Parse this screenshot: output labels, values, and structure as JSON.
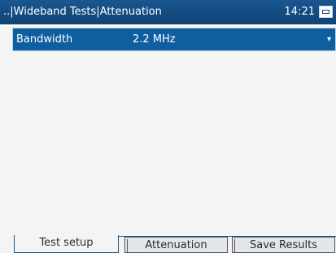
{
  "header": {
    "title": "..|Wideband Tests|Attenuation",
    "time": "14:21",
    "status_icon": "battery-charging-icon"
  },
  "parameters": [
    {
      "label": "Bandwidth",
      "value": "2.2 MHz"
    }
  ],
  "tabs": [
    {
      "label": "Test setup",
      "active": true
    },
    {
      "label": "Attenuation",
      "active": false
    },
    {
      "label": "Save Results",
      "active": false
    }
  ],
  "colors": {
    "titlebar": "#0f4374",
    "selected_row": "#0f5ea0",
    "background": "#f4f4f4"
  }
}
